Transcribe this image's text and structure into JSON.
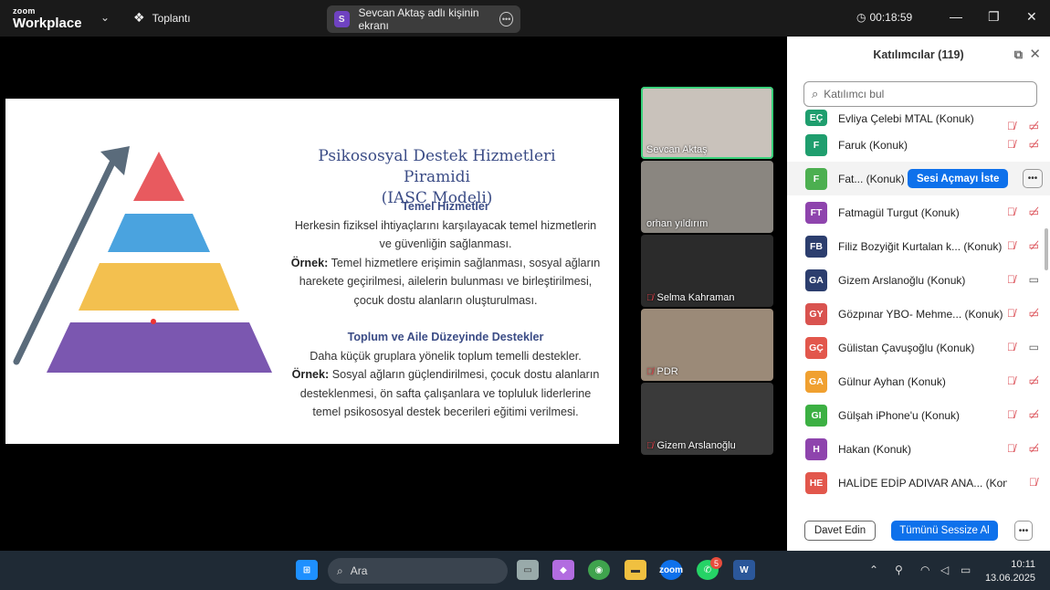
{
  "app": {
    "logo_line1": "zoom",
    "logo_line2": "Workplace",
    "meeting_label": "Toplantı",
    "share_banner": "Sevcan Aktaş adlı kişinin ekranı",
    "share_avatar": "S",
    "timer": "00:18:59"
  },
  "slide": {
    "title_line1": "Psikososyal Destek Hizmetleri Piramidi",
    "title_line2": "(IASC Modeli)",
    "s1_heading": "Temel Hizmetler",
    "s1_line1": "Herkesin fiziksel ihtiyaçlarını karşılayacak temel hizmetlerin",
    "s1_line2": "ve güvenliğin sağlanması.",
    "s1_ex_label": "Örnek:",
    "s1_ex_line1": "Temel hizmetlere erişimin sağlanması, sosyal ağların",
    "s1_ex_line2": "harekete geçirilmesi, ailelerin bulunması ve birleştirilmesi,",
    "s1_ex_line3": "çocuk dostu alanların oluşturulması.",
    "s2_heading": "Toplum ve Aile Düzeyinde Destekler",
    "s2_line1": "Daha küçük gruplara yönelik toplum temelli destekler.",
    "s2_ex_label": "Örnek:",
    "s2_ex_line1": "Sosyal ağların güçlendirilmesi, çocuk dostu alanların",
    "s2_ex_line2": "desteklenmesi, ön safta çalışanlara ve topluluk liderlerine",
    "s2_ex_line3": "temel psikososyal destek becerileri eğitimi verilmesi.",
    "pyramid_colors": [
      "#e85a5f",
      "#4aa3df",
      "#f3c04f",
      "#7b57b0"
    ]
  },
  "videos": [
    {
      "name": "Sevcan Aktaş",
      "muted": false,
      "bg": "#c9c2bb"
    },
    {
      "name": "orhan yıldırım",
      "muted": false,
      "bg": "#8a8680"
    },
    {
      "name": "Selma Kahraman",
      "muted": true,
      "bg": "#2b2b2b"
    },
    {
      "name": "PDR",
      "muted": true,
      "bg": "#9b8a78"
    },
    {
      "name": "Gizem Arslanoğlu",
      "muted": true,
      "bg": "#3a3a3a"
    }
  ],
  "panel": {
    "title": "Katılımcılar (119)",
    "search_placeholder": "Katılımcı bul",
    "ask_unmute": "Sesi Açmayı İste",
    "invite": "Davet Edin",
    "mute_all": "Tümünü Sessize Al",
    "participants": [
      {
        "initials": "EÇ",
        "name": "Evliya Çelebi MTAL (Konuk)",
        "color": "#1f9e6e",
        "cam": "off"
      },
      {
        "initials": "F",
        "name": "Faruk (Konuk)",
        "color": "#1f9e6e",
        "cam": "off"
      },
      {
        "initials": "F",
        "name": "Fat...  (Konuk)",
        "color": "#4caf50",
        "cam": "off"
      },
      {
        "initials": "FT",
        "name": "Fatmagül Turgut (Konuk)",
        "color": "#8e44ad",
        "cam": "off"
      },
      {
        "initials": "FB",
        "name": "Filiz Bozyiğit Kurtalan k...  (Konuk)",
        "color": "#2c3e6e",
        "cam": "off"
      },
      {
        "initials": "GA",
        "name": "Gizem Arslanoğlu (Konuk)",
        "color": "#2c3e6e",
        "cam": "on"
      },
      {
        "initials": "GY",
        "name": "Gözpınar YBO- Mehme...  (Konuk)",
        "color": "#d9534f",
        "cam": "off"
      },
      {
        "initials": "GÇ",
        "name": "Gülistan Çavuşoğlu (Konuk)",
        "color": "#e2574c",
        "cam": "on"
      },
      {
        "initials": "GA",
        "name": "Gülnur Ayhan (Konuk)",
        "color": "#f0a030",
        "cam": "off"
      },
      {
        "initials": "GI",
        "name": "Gülşah iPhone'u (Konuk)",
        "color": "#3cb043",
        "cam": "off"
      },
      {
        "initials": "H",
        "name": "Hakan (Konuk)",
        "color": "#8e44ad",
        "cam": "off"
      },
      {
        "initials": "HE",
        "name": "HALİDE EDİP ADIVAR ANA...  (Konuk)",
        "color": "#e2574c",
        "cam": "none"
      }
    ]
  },
  "taskbar": {
    "search": "Ara",
    "time": "10:11",
    "date": "13.06.2025",
    "whatsapp_badge": "5"
  }
}
